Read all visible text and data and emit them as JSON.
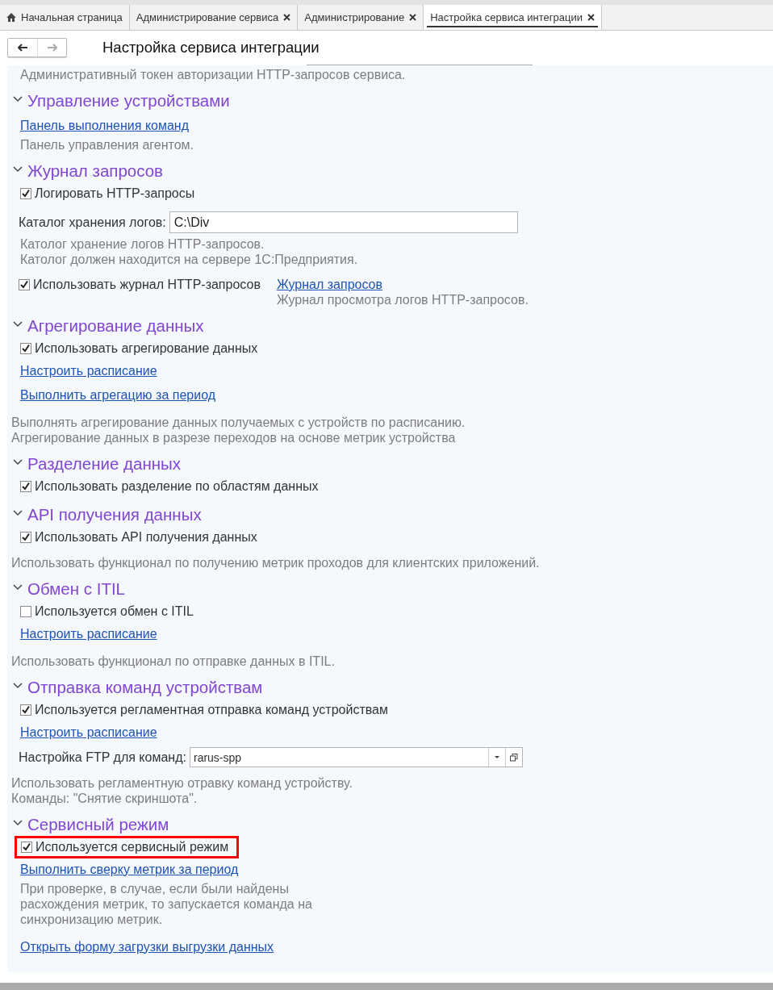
{
  "tabs": [
    {
      "label": "Начальная страница",
      "kind": "home",
      "selected": false
    },
    {
      "label": "Администрирование сервиса",
      "kind": "closable",
      "selected": false
    },
    {
      "label": "Администрирование",
      "kind": "closable",
      "selected": false
    },
    {
      "label": "Настройка сервиса интеграции",
      "kind": "closable",
      "selected": true
    }
  ],
  "form": {
    "title": "Настройка сервиса интеграции",
    "top_note": "Административный токен авторизации HTTP-запросов сервиса.",
    "sections": [
      {
        "title": "Управление устройствами",
        "expanded": true,
        "items": [
          {
            "kind": "link",
            "text": "Панель выполнения команд"
          },
          {
            "kind": "note",
            "text": "Панель управления агентом."
          }
        ]
      },
      {
        "title": "Журнал запросов",
        "expanded": true,
        "items": [
          {
            "kind": "checkbox",
            "label": "Логировать HTTP-запросы",
            "checked": true
          },
          {
            "kind": "field",
            "label": "Каталог хранения логов:",
            "value": "C:\\Div"
          },
          {
            "kind": "note",
            "text": "Католог хранение логов HTTP-запросов."
          },
          {
            "kind": "note",
            "text": "Католог должен находится на сервере 1С:Предприятия."
          },
          {
            "kind": "checklink",
            "label": "Использовать журнал HTTP-запросов",
            "checked": true,
            "link": "Журнал запросов",
            "note": "Журнал просмотра логов HTTP-запросов."
          }
        ]
      },
      {
        "title": "Агрегирование данных",
        "expanded": true,
        "items": [
          {
            "kind": "checkbox",
            "label": "Использовать агрегирование данных",
            "checked": true
          },
          {
            "kind": "link",
            "text": "Настроить расписание"
          },
          {
            "kind": "link",
            "text": "Выполнить агрегацию за период"
          },
          {
            "kind": "description",
            "text": "Выполнять агрегирование данных получаемых с устройств по расписанию."
          },
          {
            "kind": "description",
            "text": "Агрегирование данных в разрезе переходов на основе метрик устройства"
          }
        ]
      },
      {
        "title": "Разделение данных",
        "expanded": true,
        "items": [
          {
            "kind": "checkbox",
            "label": "Использовать разделение по областям данных",
            "checked": true
          }
        ]
      },
      {
        "title": "API получения данных",
        "expanded": true,
        "items": [
          {
            "kind": "checkbox",
            "label": "Использовать API получения данных",
            "checked": true
          },
          {
            "kind": "description",
            "text": "Использовать функционал по получению метрик проходов для клиентских приложений."
          }
        ]
      },
      {
        "title": "Обмен с ITIL",
        "expanded": true,
        "items": [
          {
            "kind": "checkbox",
            "label": "Используется обмен с ITIL",
            "checked": false
          },
          {
            "kind": "link",
            "text": "Настроить расписание"
          },
          {
            "kind": "description",
            "text": "Использовать функционал по отправке данных в ITIL."
          }
        ]
      },
      {
        "title": "Отправка команд устройствам",
        "expanded": true,
        "items": [
          {
            "kind": "checkbox",
            "label": "Используется регламентная отправка команд устройствам",
            "checked": true
          },
          {
            "kind": "link",
            "text": "Настроить расписание"
          },
          {
            "kind": "select",
            "label": "Настройка FTP для команд:",
            "value": "rarus-spp"
          },
          {
            "kind": "description",
            "text": "Использовать регламентную отравку команд устройству."
          },
          {
            "kind": "description",
            "text": "Команды: \"Снятие скриншота\"."
          }
        ]
      },
      {
        "title": "Сервисный режим",
        "expanded": true,
        "items": [
          {
            "kind": "checkbox",
            "label": "Используется сервисный режим",
            "checked": true,
            "highlighted": true
          },
          {
            "kind": "link",
            "text": "Выполнить сверку метрик за период"
          },
          {
            "kind": "paragraph",
            "text": " При проверке, в случае, если были найдены расхождения метрик, то запускается команда на синхронизацию метрик."
          },
          {
            "kind": "link",
            "text": "Открыть форму загрузки выгрузки данных"
          }
        ]
      }
    ]
  }
}
